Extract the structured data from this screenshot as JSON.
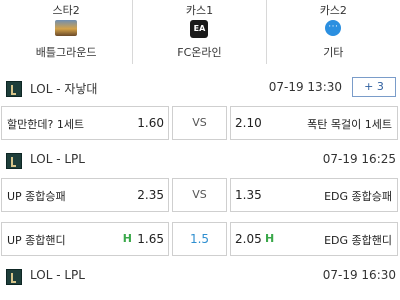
{
  "categories": [
    {
      "top": "스타2",
      "icon": "battleground-icon",
      "bottom": "배틀그라운드"
    },
    {
      "top": "카스1",
      "icon": "ea-icon",
      "icon_text": "EA",
      "bottom": "FC온라인"
    },
    {
      "top": "카스2",
      "icon": "more-dots-icon",
      "icon_text": "···",
      "bottom": "기타"
    }
  ],
  "matches": [
    {
      "league": "LOL - 자낳대",
      "datetime": "07-19 13:30",
      "more": "+ 3",
      "rows": [
        {
          "home": "할만한데? 1세트",
          "home_odd": "1.60",
          "mid": "VS",
          "away_odd": "2.10",
          "away": "폭탄 목걸이 1세트"
        }
      ]
    },
    {
      "league": "LOL - LPL",
      "datetime": "07-19 16:25",
      "rows": [
        {
          "home": "UP 종합승패",
          "home_odd": "2.35",
          "mid": "VS",
          "away_odd": "1.35",
          "away": "EDG 종합승패"
        },
        {
          "home": "UP 종합핸디",
          "home_mark": "H",
          "home_odd": "1.65",
          "mid": "1.5",
          "away_odd": "2.05",
          "away_mark": "H",
          "away": "EDG 종합핸디"
        }
      ]
    },
    {
      "league": "LOL - LPL",
      "datetime": "07-19 16:30"
    }
  ],
  "colors": {
    "accent": "#2f8fd0",
    "handicap_mark": "#3aa84a",
    "more_border": "#7a9cc9"
  }
}
